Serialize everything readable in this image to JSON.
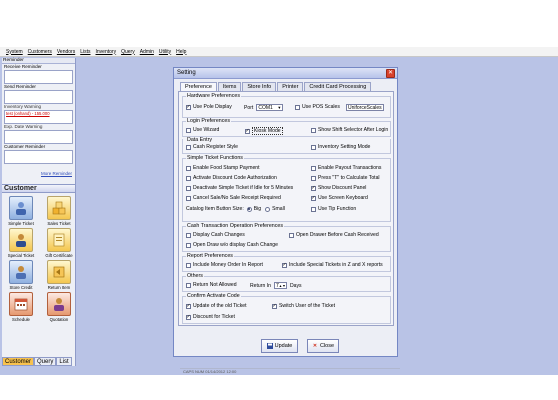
{
  "menu": [
    "System",
    "Customers",
    "Vendors",
    "Lists",
    "Inventory",
    "Query",
    "Admin",
    "Utility",
    "Help"
  ],
  "reminders": {
    "title": "Reminder",
    "sections": [
      {
        "label": "Receive Reminder",
        "content": ""
      },
      {
        "label": "Send Reminder",
        "content": ""
      },
      {
        "label": "Inventory Warning",
        "content": "test (onhand) - 155.000"
      },
      {
        "label": "Exp. Date Warning",
        "content": ""
      },
      {
        "label": "Customer Reminder",
        "content": ""
      }
    ],
    "more": "More Reminder"
  },
  "customer_panel": {
    "title": "Customer",
    "items": [
      {
        "label": "Simple Ticket",
        "icon": "simple-ticket-icon"
      },
      {
        "label": "Sales Ticket",
        "icon": "sales-ticket-icon"
      },
      {
        "label": "Special Ticket",
        "icon": "special-ticket-icon"
      },
      {
        "label": "Gift Certificate",
        "icon": "gift-certificate-icon"
      },
      {
        "label": "Store Credit",
        "icon": "store-credit-icon"
      },
      {
        "label": "Return Item",
        "icon": "return-item-icon"
      },
      {
        "label": "Schedule",
        "icon": "schedule-icon"
      },
      {
        "label": "Quotation",
        "icon": "quotation-icon"
      }
    ],
    "tabs": [
      "Customer",
      "Query",
      "List"
    ],
    "active_tab": "Customer"
  },
  "status": "CAPS  NUM  01/14/2012  12:00",
  "dialog": {
    "title": "Setting",
    "tabs": [
      "Preference",
      "Items",
      "Store Info",
      "Printer",
      "Credit Card Processing"
    ],
    "active_tab": "Preference",
    "hardware": {
      "title": "Hardware Preferences",
      "use_pole_display": "Use Pole Display",
      "port_label": "Port",
      "port_value": "COM1",
      "use_pos_scales": "Use POS Scales",
      "scale_value": "UniforceScales"
    },
    "login": {
      "title": "Login Preferences",
      "use_wizard": "Use Wizard",
      "kiosk_mode": "Kiosk Mode",
      "show_shift": "Show Shift Selector After Login"
    },
    "data_entry": {
      "title": "Data Entry",
      "cash_register_style": "Cash Register Style",
      "inventory_setting_mode": "Inventory Setting Mode"
    },
    "simple_ticket": {
      "title": "Simple Ticket Functions",
      "left": [
        "Enable Food Stamp Payment",
        "Activate Discount Code Authorization",
        "Deactivate Simple Ticket if Idle for 5 Minutes",
        "Cancel Sale/No Sale Receipt Required"
      ],
      "right": [
        "Enable Payout Transactions",
        "Press \"T\" to Calculate Total",
        "Show Discount Panel",
        "Use Screen Keyboard"
      ],
      "size_label": "Catalog Item Button Size:",
      "size_big": "Big",
      "size_small": "Small",
      "use_tip": "Use Tip Function"
    },
    "cash": {
      "title": "Cash Transaction Operation Preferences",
      "display_changes": "Display Cash Changes",
      "open_drawer_before": "Open Drawer Before Cash Received",
      "open_draw_wo": "Open Draw w/o display Cash Change"
    },
    "report": {
      "title": "Report Preferences",
      "include_money_order": "Include Money Order In Report",
      "include_special": "Include Special Tickets in Z and X reports"
    },
    "others": {
      "title": "Others",
      "return_not_allowed": "Return Not Allowed",
      "return_in_label": "Return In",
      "return_days": "7",
      "days_label": "Days"
    },
    "confirm": {
      "title": "Confirm  Activate Code",
      "update_old": "Update of the old Ticket",
      "switch_user": "Switch User of the Ticket",
      "discount": "Discount for Ticket"
    },
    "buttons": {
      "update": "Update",
      "close": "Close"
    }
  }
}
